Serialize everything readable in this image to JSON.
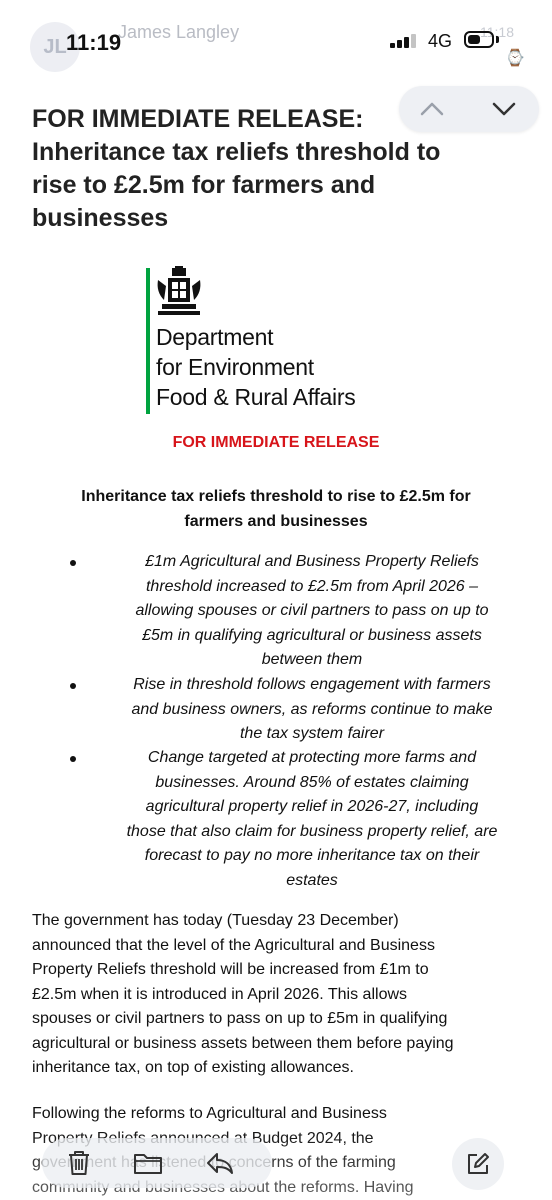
{
  "status_bar": {
    "avatar_initials": "JL",
    "sender_name": "James Langley",
    "faded_time": "11:18",
    "time": "11:19",
    "network": "4G",
    "battery_level": 0.55
  },
  "heading": {
    "lines": [
      "FOR IMMEDIATE RELEASE:",
      "Inheritance tax reliefs threshold to",
      "rise to £2.5m for farmers and",
      "businesses"
    ]
  },
  "logo": {
    "lines": [
      "Department",
      "for Environment",
      "Food & Rural Affairs"
    ],
    "color": "#00a33f"
  },
  "release_label": "FOR IMMEDIATE RELEASE",
  "subheading_lines": [
    "Inheritance tax reliefs threshold to rise to £2.5m for",
    "farmers and businesses"
  ],
  "bullets": [
    {
      "lines": [
        "£1m Agricultural and Business Property Reliefs",
        "threshold increased to £2.5m from April 2026 –",
        "allowing spouses or civil partners to pass on up to",
        "£5m in qualifying agricultural or business assets",
        "between them"
      ]
    },
    {
      "lines": [
        "Rise in threshold follows engagement with farmers",
        "and business owners, as reforms continue to make",
        "the tax system fairer"
      ]
    },
    {
      "lines": [
        "Change targeted at protecting more farms and",
        "businesses. Around 85% of estates claiming",
        "agricultural property relief in 2026-27, including",
        "those that also claim for business property relief, are",
        "forecast to pay no more inheritance tax on their",
        "estates"
      ]
    }
  ],
  "paragraph1": {
    "lines": [
      "The government has today (Tuesday 23 December)",
      "announced that the level of the Agricultural and Business",
      "Property Reliefs threshold will be increased from £1m to",
      "£2.5m when it is introduced in April 2026. This allows",
      "spouses or civil partners to pass on up to £5m in qualifying",
      "agricultural or business assets between them before paying",
      "inheritance tax, on top of existing allowances."
    ]
  },
  "paragraph2": {
    "lines": [
      "Following the reforms to Agricultural and Business",
      "Property Reliefs announced at Budget 2024, the",
      "government has listened to concerns of the farming",
      "community and businesses about the reforms. Having"
    ]
  },
  "toolbar": {
    "icons": [
      "trash-icon",
      "folder-icon",
      "reply-icon",
      "compose-icon"
    ],
    "nav_icons": [
      "chevron-up-icon",
      "chevron-down-icon"
    ]
  }
}
